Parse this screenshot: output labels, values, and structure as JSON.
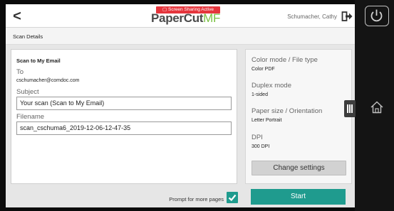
{
  "header": {
    "back_icon": "chevron-left-icon",
    "back_glyph": "<",
    "sharing_badge": "Screen Sharing Active",
    "logo_main": "PaperCut",
    "logo_mf": "MF",
    "user_name": "Schumacher, Cathy",
    "logout_icon": "logout-icon"
  },
  "section": {
    "title": "Scan Details"
  },
  "scan": {
    "heading": "Scan to My Email",
    "to_label": "To",
    "to_value": "cschumacher@comdoc.com",
    "subject_label": "Subject",
    "subject_value": "Your scan (Scan to My Email)",
    "filename_label": "Filename",
    "filename_value": "scan_cschuma6_2019-12-06-12-47-35"
  },
  "settings": {
    "color_label": "Color mode / File type",
    "color_value": "Color PDF",
    "duplex_label": "Duplex mode",
    "duplex_value": "1-sided",
    "paper_label": "Paper size / Orientation",
    "paper_value": "Letter Portrait",
    "dpi_label": "DPI",
    "dpi_value": "300 DPI",
    "change_button": "Change settings"
  },
  "footer": {
    "prompt_label": "Prompt for more pages",
    "prompt_checked": true,
    "start_button": "Start"
  },
  "device": {
    "power_icon": "power-icon",
    "home_icon": "home-icon",
    "drawer_icon": "drawer-handle-icon"
  },
  "colors": {
    "accent": "#1f9b8e",
    "badge": "#e5353c",
    "logo_mf": "#7ac142"
  }
}
